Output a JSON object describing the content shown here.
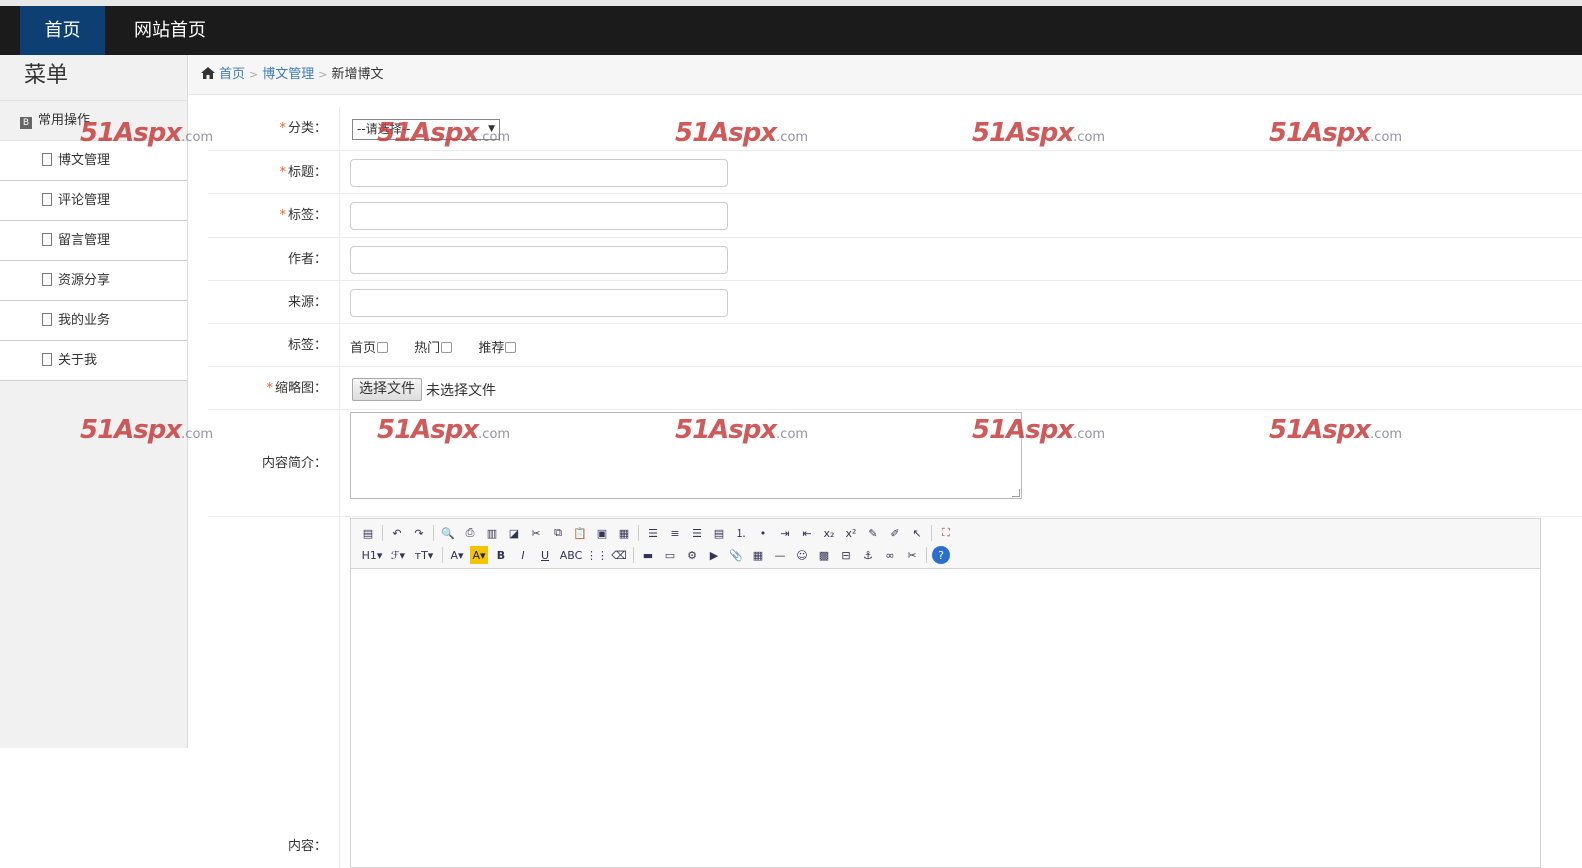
{
  "navbar": {
    "items": [
      {
        "label": "首页",
        "active": true
      },
      {
        "label": "网站首页",
        "active": false
      }
    ]
  },
  "sidebar": {
    "title": "菜单",
    "group": "常用操作",
    "items": [
      {
        "label": "博文管理"
      },
      {
        "label": "评论管理"
      },
      {
        "label": "留言管理"
      },
      {
        "label": "资源分享"
      },
      {
        "label": "我的业务"
      },
      {
        "label": "关于我"
      }
    ]
  },
  "breadcrumb": {
    "home": "首页",
    "section": "博文管理",
    "current": "新增博文"
  },
  "form": {
    "category_label": "分类：",
    "category_value": "--请选择--",
    "title_label": "标题：",
    "tags_label": "标签：",
    "author_label": "作者：",
    "source_label": "来源：",
    "flags_label": "标签：",
    "flags": [
      "首页",
      "热门",
      "推荐"
    ],
    "thumb_label": "缩略图：",
    "file_button": "选择文件",
    "file_status": "未选择文件",
    "summary_label": "内容简介：",
    "content_label": "内容："
  },
  "editor": {
    "toolbar_row1": [
      "source-icon",
      "undo-icon",
      "redo-icon",
      "preview-icon",
      "print-icon",
      "template-icon",
      "code-icon",
      "cut-icon",
      "copy-icon",
      "paste-icon",
      "paste-text-icon",
      "paste-word-icon",
      "align-left-icon",
      "align-center-icon",
      "align-right-icon",
      "justify-icon",
      "ordered-list-icon",
      "unordered-list-icon",
      "indent-icon",
      "outdent-icon",
      "subscript-icon",
      "superscript-icon",
      "clear-format-icon",
      "select-all-icon",
      "cursor-icon",
      "fullscreen-icon"
    ],
    "toolbar_row2": [
      "heading-icon",
      "font-family-icon",
      "font-size-icon",
      "font-color-icon",
      "highlight-icon",
      "bold-icon",
      "italic-icon",
      "underline-icon",
      "strikethrough-icon",
      "line-height-icon",
      "eraser-icon",
      "image-icon",
      "multi-image-icon",
      "flash-icon",
      "media-icon",
      "attachment-icon",
      "table-icon",
      "hr-icon",
      "emoticon-icon",
      "map-icon",
      "page-break-icon",
      "anchor-icon",
      "link-icon",
      "unlink-icon",
      "help-icon"
    ]
  },
  "watermark": {
    "brand": "51Aspx",
    "suffix": ".com"
  }
}
